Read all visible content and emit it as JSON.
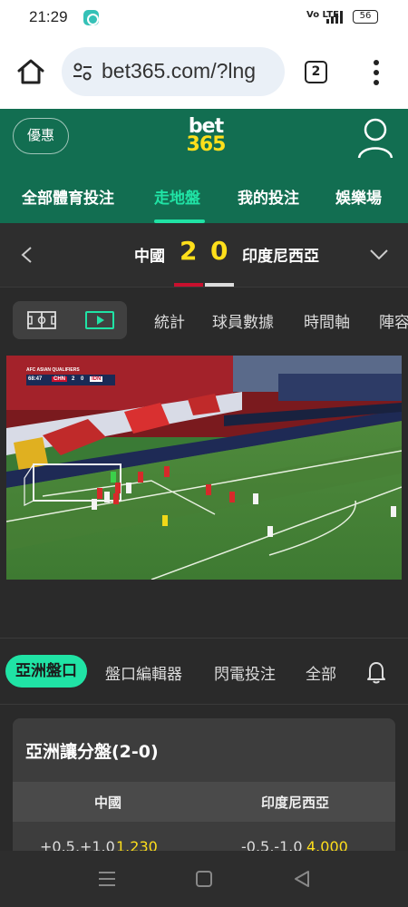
{
  "status_bar": {
    "time": "21:29",
    "signal": "Vo LTE",
    "network": "4G",
    "battery": "56"
  },
  "browser": {
    "url": "bet365.com/?lng",
    "tab_count": "2"
  },
  "header": {
    "promo": "優惠",
    "logo_top": "bet",
    "logo_bottom": "365",
    "nav": [
      "全部體育投注",
      "走地盤",
      "我的投注",
      "娛樂場"
    ],
    "active_nav": "走地盤"
  },
  "match": {
    "home_team": "中國",
    "home_score": "2",
    "away_score": "0",
    "away_team": "印度尼西亞"
  },
  "media_tabs": [
    "統計",
    "球員數據",
    "時間軸",
    "陣容"
  ],
  "video": {
    "scorebug_title": "AFC ASIAN QUALIFIERS",
    "scorebug_time": "68:47",
    "home_code": "CHN",
    "home_score": "2",
    "away_score": "0",
    "away_code": "IDN"
  },
  "market_tabs": [
    "亞洲盤口",
    "盤口編輯器",
    "閃電投注",
    "全部"
  ],
  "active_market_tab": "亞洲盤口",
  "market": {
    "title": "亞洲讓分盤(2-0)",
    "home_label": "中國",
    "away_label": "印度尼西亞",
    "home_handicap": "+0.5,+1.0",
    "home_price": "1.230",
    "away_handicap": "-0.5,-1.0",
    "away_price": "4.000"
  },
  "colors": {
    "brand_green": "#126e51",
    "accent": "#20e3a5",
    "odds_yellow": "#ffdf1b",
    "background": "#2a2a2a"
  }
}
